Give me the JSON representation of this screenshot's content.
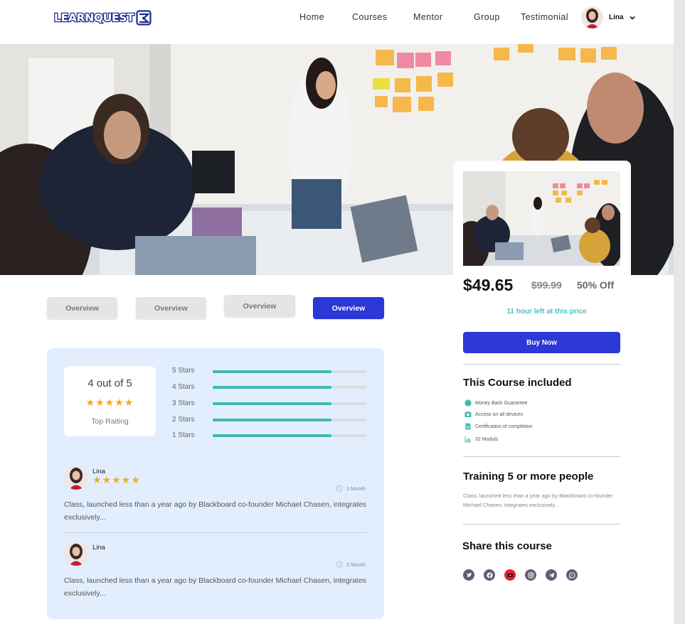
{
  "nav": {
    "logo_text": "LEARNQUEST",
    "links": [
      "Home",
      "Courses",
      "Mentor",
      "Group",
      "Testimonial"
    ],
    "user_name": "Lina"
  },
  "tabs": [
    {
      "label": "Overview",
      "active": false
    },
    {
      "label": "Overview",
      "active": false
    },
    {
      "label": "Overview",
      "active": false
    },
    {
      "label": "Overview",
      "active": true
    }
  ],
  "rating": {
    "value_text": "4 out of 5",
    "stars": "★★★★★",
    "caption": "Top Raiting",
    "breakdown": [
      {
        "label": "5 Stars",
        "fill": 0.77
      },
      {
        "label": "4 Stars",
        "fill": 0.77
      },
      {
        "label": "3 Stars",
        "fill": 0.77
      },
      {
        "label": "2 Stars",
        "fill": 0.77
      },
      {
        "label": "1 Stars",
        "fill": 0.77
      }
    ]
  },
  "reviews": [
    {
      "name": "Lina",
      "stars": "★★★★★",
      "time": "3 Month",
      "text": "Class, launched less than a year ago by Blackboard co-founder Michael Chasen, integrates exclusively..."
    },
    {
      "name": "Lina",
      "stars": "",
      "time": "3 Month",
      "text": "Class, launched less than a year ago by Blackboard co-founder Michael Chasen, integrates exclusively..."
    }
  ],
  "purchase": {
    "price": "$49.65",
    "old_price": "$99.99",
    "discount": "50% Off",
    "time_left": "11 hour left at this price",
    "buy_label": "Buy Now"
  },
  "included": {
    "heading": "This Course included",
    "items": [
      {
        "icon": "money-back-icon",
        "label": "Money Back Guarantee"
      },
      {
        "icon": "devices-icon",
        "label": "Access on all devices"
      },
      {
        "icon": "certificate-icon",
        "label": "Certification of completion"
      },
      {
        "icon": "modules-icon",
        "label": "32 Moduls"
      }
    ]
  },
  "training": {
    "heading": "Training 5 or more people",
    "text": "Class, launched less than a year ago by Blackboard co-founder Michael Chasen, integrates exclusively..."
  },
  "share": {
    "heading": "Share this course",
    "icons": [
      "twitter-icon",
      "facebook-icon",
      "youtube-icon",
      "instagram-icon",
      "telegram-icon",
      "whatsapp-icon"
    ]
  },
  "colors": {
    "accent": "#2b38d6",
    "teal": "#3fb8b3",
    "star": "#f7a81b",
    "youtube": "#ee1c25",
    "review_card": "#e2eefd"
  }
}
